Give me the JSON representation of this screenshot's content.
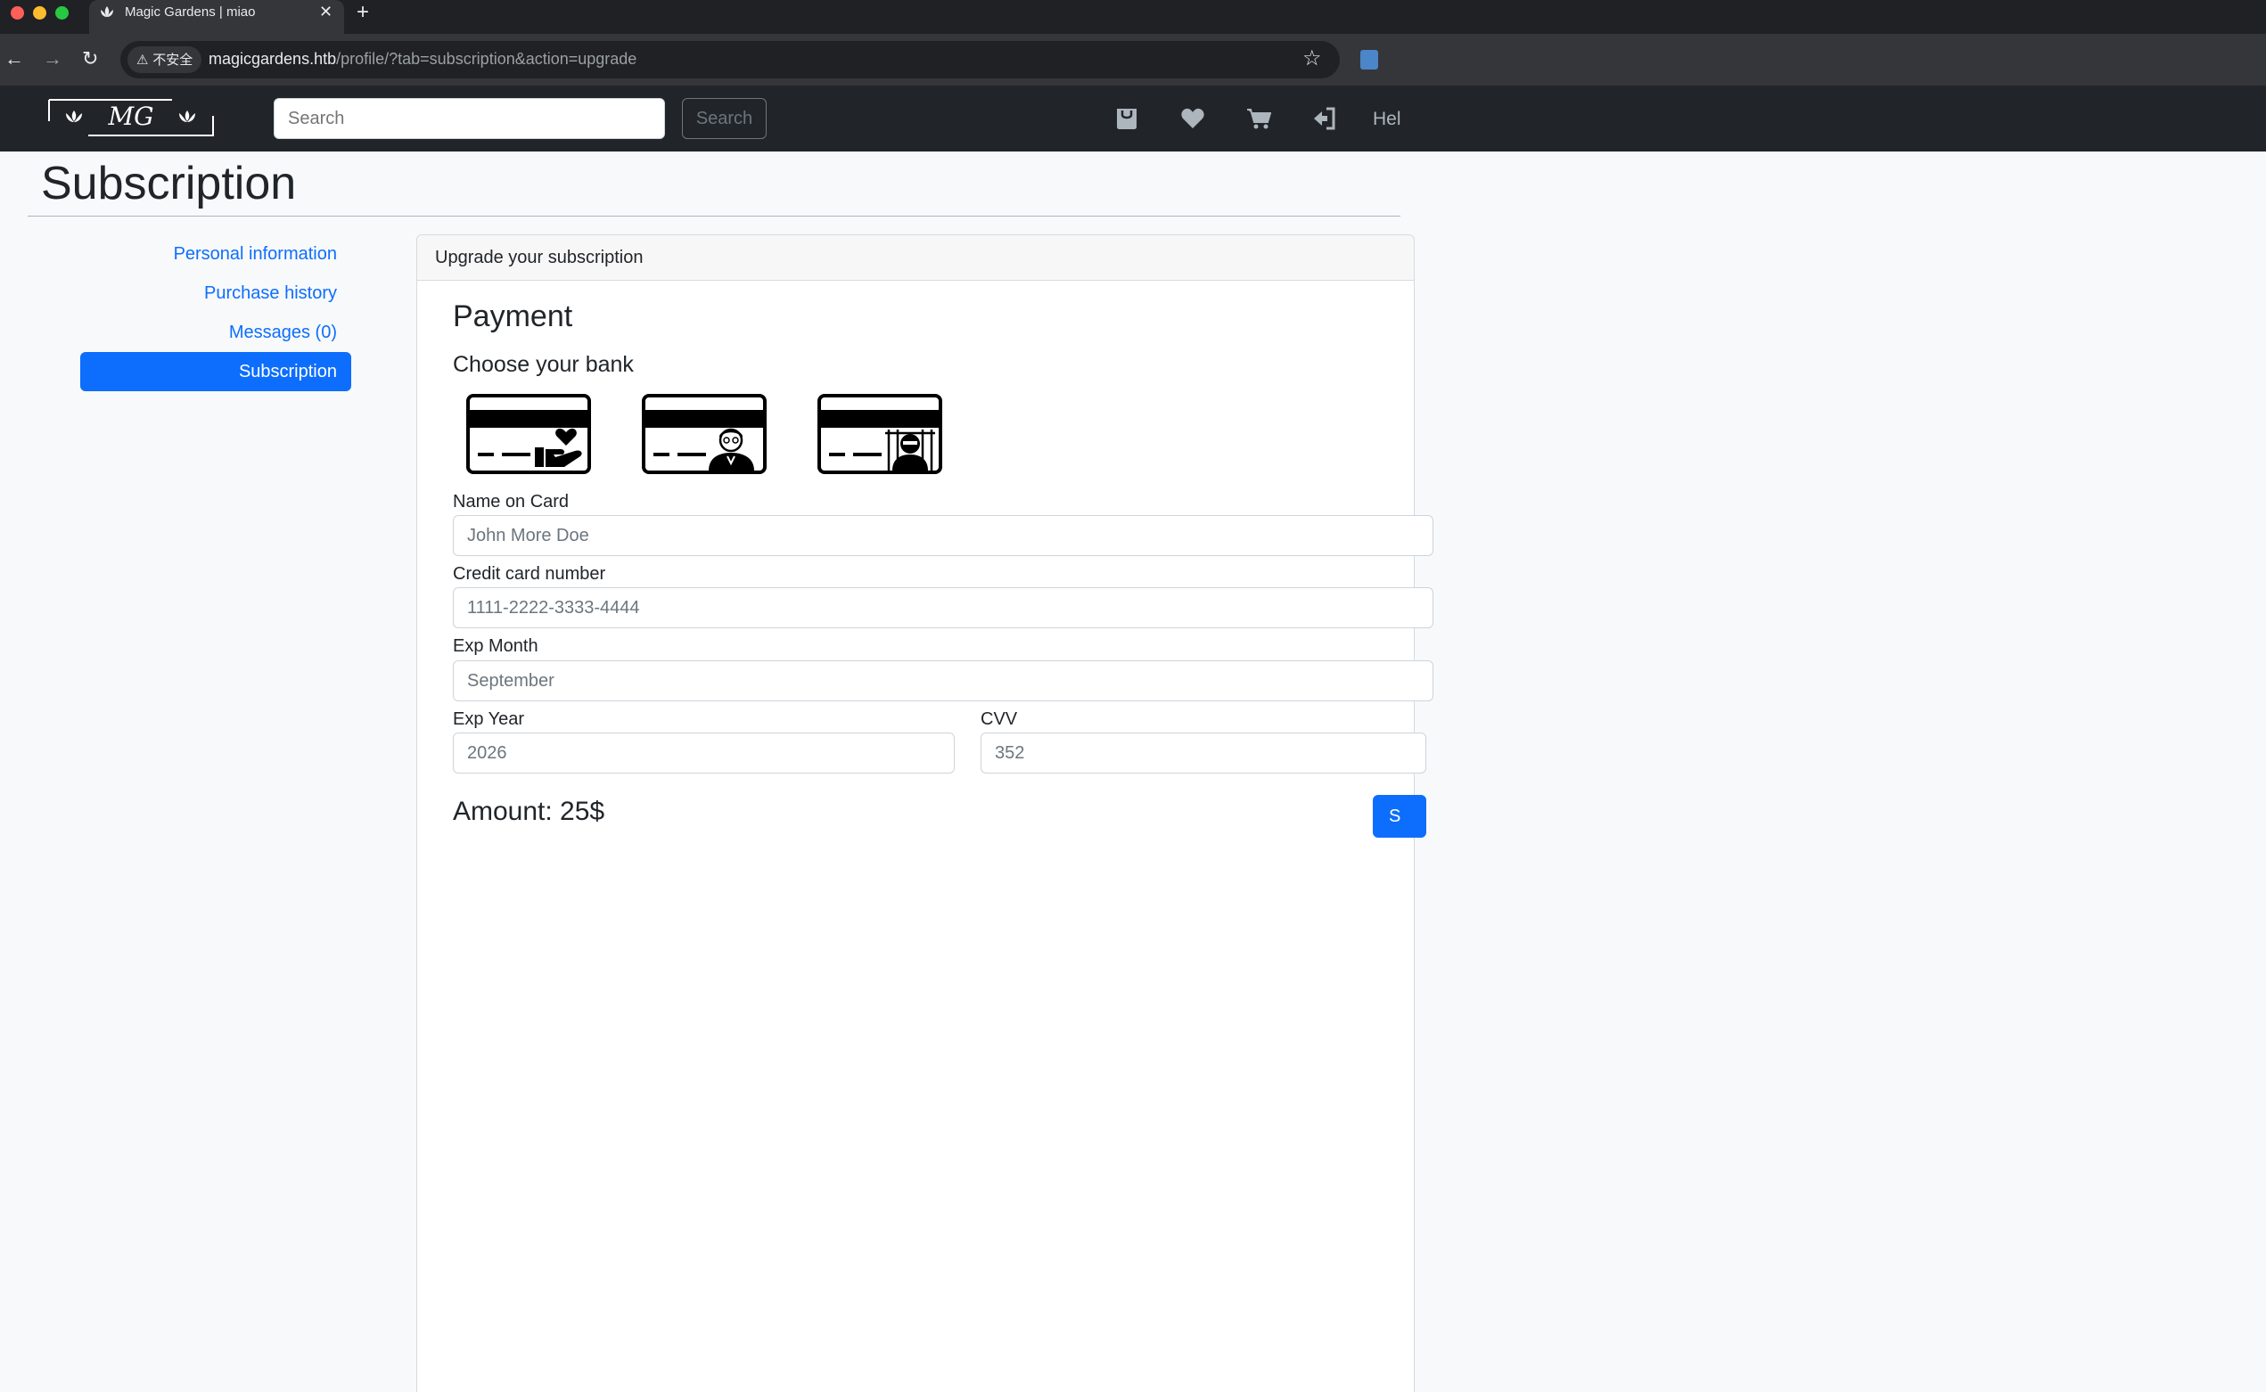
{
  "browser": {
    "tab_title": "Magic Gardens | miao",
    "tab_close": "✕",
    "new_tab": "+",
    "security_label": "⚠ 不安全",
    "url_host": "magicgardens.htb",
    "url_path": "/profile/?tab=subscription&action=upgrade",
    "back": "←",
    "forward": "→",
    "reload": "↻",
    "bookmark": "☆"
  },
  "navbar": {
    "logo_text": "MG",
    "search_placeholder": "Search",
    "search_button": "Search",
    "icons": [
      "shopping-bag-icon",
      "heart-icon",
      "cart-icon",
      "sign-in-icon"
    ],
    "help_label": "Hel"
  },
  "page": {
    "title": "Subscription"
  },
  "sidebar": {
    "items": [
      {
        "label": "Personal information",
        "active": false
      },
      {
        "label": "Purchase history",
        "active": false
      },
      {
        "label": "Messages (0)",
        "active": false
      },
      {
        "label": "Subscription",
        "active": true
      }
    ]
  },
  "card": {
    "header": "Upgrade your subscription",
    "payment_heading": "Payment",
    "bank_heading": "Choose your bank",
    "banks": [
      "bank-card-heart-hand-icon",
      "bank-card-elder-icon",
      "bank-card-prisoner-icon"
    ],
    "fields": {
      "name_label": "Name on Card",
      "name_value": "John More Doe",
      "card_label": "Credit card number",
      "card_value": "1111-2222-3333-4444",
      "month_label": "Exp Month",
      "month_value": "September",
      "year_label": "Exp Year",
      "year_value": "2026",
      "cvv_label": "CVV",
      "cvv_value": "352"
    },
    "amount": "Amount: 25$",
    "submit_label": "S"
  },
  "colors": {
    "primary": "#0d6efd",
    "navbar": "#212529",
    "page_bg": "#f8f9fa"
  }
}
